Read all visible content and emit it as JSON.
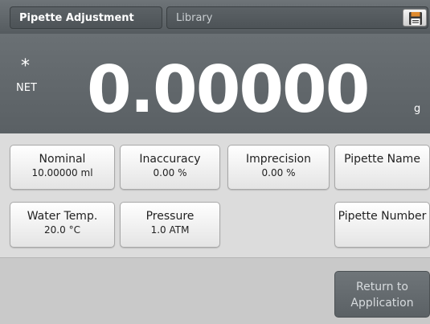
{
  "header": {
    "app_tab": "Pipette Adjustment",
    "library_tab": "Library",
    "save_icon": "floppy-disk-icon"
  },
  "display": {
    "indicator": "*",
    "mode": "NET",
    "weight": "0.00000",
    "unit": "g"
  },
  "buttons": {
    "nominal": {
      "label": "Nominal",
      "value": "10.00000 ml"
    },
    "inaccuracy": {
      "label": "Inaccuracy",
      "value": "0.00 %"
    },
    "imprecision": {
      "label": "Imprecision",
      "value": "0.00 %"
    },
    "pipette_name": {
      "label": "Pipette Name"
    },
    "water_temp": {
      "label": "Water Temp.",
      "value": "20.0 °C"
    },
    "pressure": {
      "label": "Pressure",
      "value": "1.0 ATM"
    },
    "pipette_number": {
      "label": "Pipette Number"
    }
  },
  "footer": {
    "return_line1": "Return to",
    "return_line2": "Application"
  },
  "colors": {
    "header_bg": "#5f6569",
    "display_bg": "#646a6e",
    "button_bg": "#f2f2f2",
    "footer_bg": "#c9c9c9",
    "accent_orange": "#e08a2c"
  }
}
